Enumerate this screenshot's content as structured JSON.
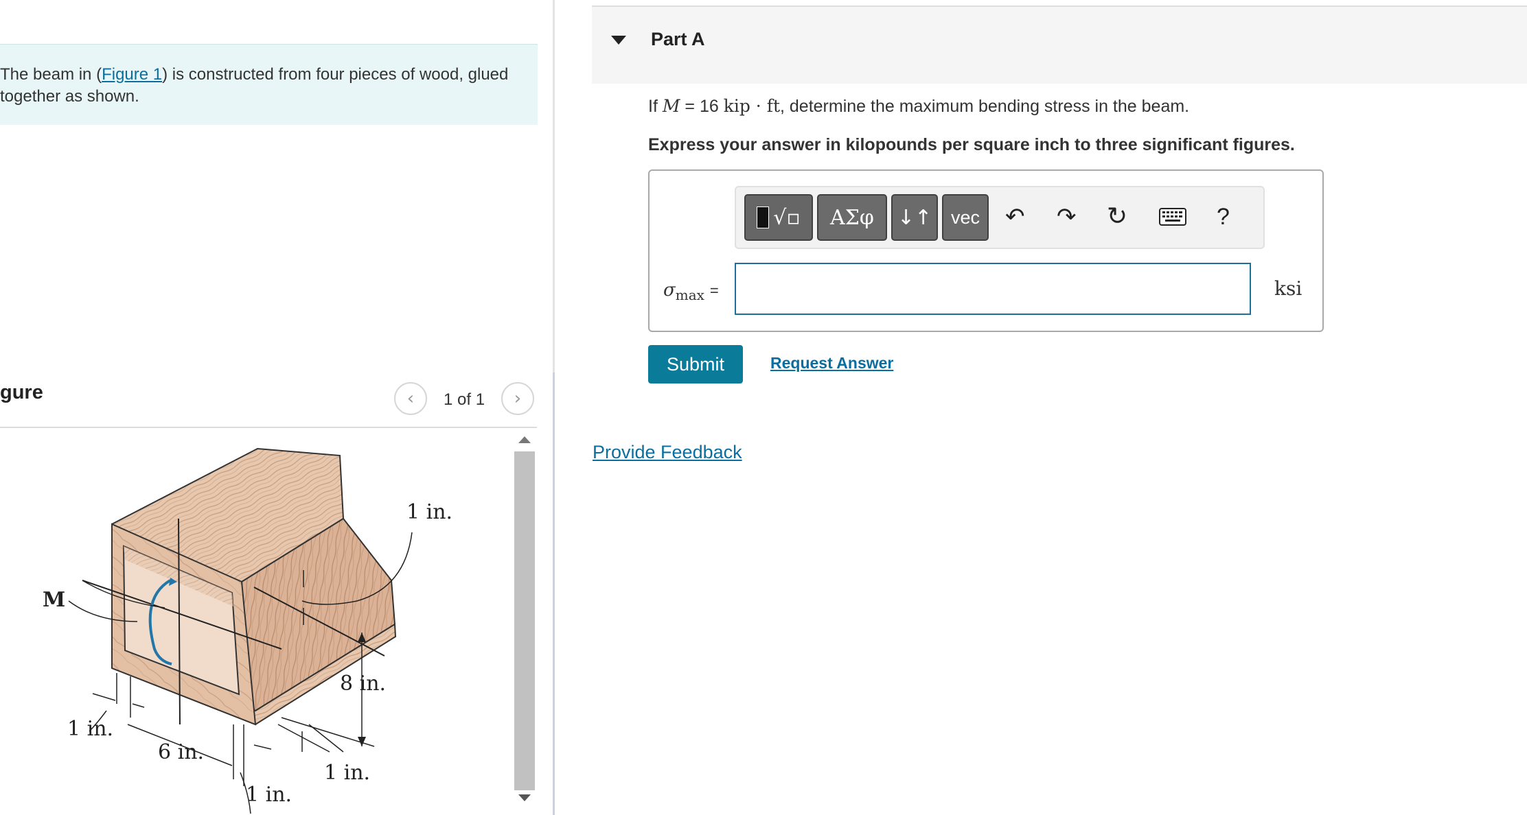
{
  "problem": {
    "text_before": "The beam in (",
    "figure_link": "Figure 1",
    "text_after": ") is constructed from four pieces of wood, glued together as shown."
  },
  "figure": {
    "heading": "gure",
    "counter": "1 of 1",
    "prev_icon": "chevron-left",
    "next_icon": "chevron-right",
    "labels": {
      "moment": "M",
      "top_thickness": "1 in.",
      "height": "8 in.",
      "left_flange": "1 in.",
      "inner_width": "6 in.",
      "web_bottom": "1 in.",
      "right_web": "1 in."
    }
  },
  "part": {
    "title": "Part A",
    "toggle_icon": "caret-down",
    "question": {
      "prefix": "If ",
      "symbol": "M",
      "equals": " = 16 ",
      "unit": "kip · ft",
      "suffix": ", determine the maximum bending stress in the beam."
    },
    "instruction": "Express your answer in kilopounds per square inch to three significant figures.",
    "toolbar": {
      "templates_icon": "templates-icon",
      "greek": "ΑΣφ",
      "updown": "↓↑",
      "vec": "vec",
      "undo_icon": "undo",
      "redo_icon": "redo",
      "reset_icon": "reset",
      "keyboard_icon": "keyboard",
      "help": "?"
    },
    "answer": {
      "label_symbol": "σ",
      "label_sub": "max",
      "label_eq": "=",
      "value": "",
      "unit": "ksi"
    },
    "submit_label": "Submit",
    "request_answer_label": "Request Answer"
  },
  "feedback_label": "Provide Feedback",
  "colors": {
    "link": "#0a6fa0",
    "submit_bg": "#0b7b9a",
    "statement_bg": "#e8f6f7",
    "input_border": "#1c6f98",
    "arrow_blue": "#2277a8"
  }
}
